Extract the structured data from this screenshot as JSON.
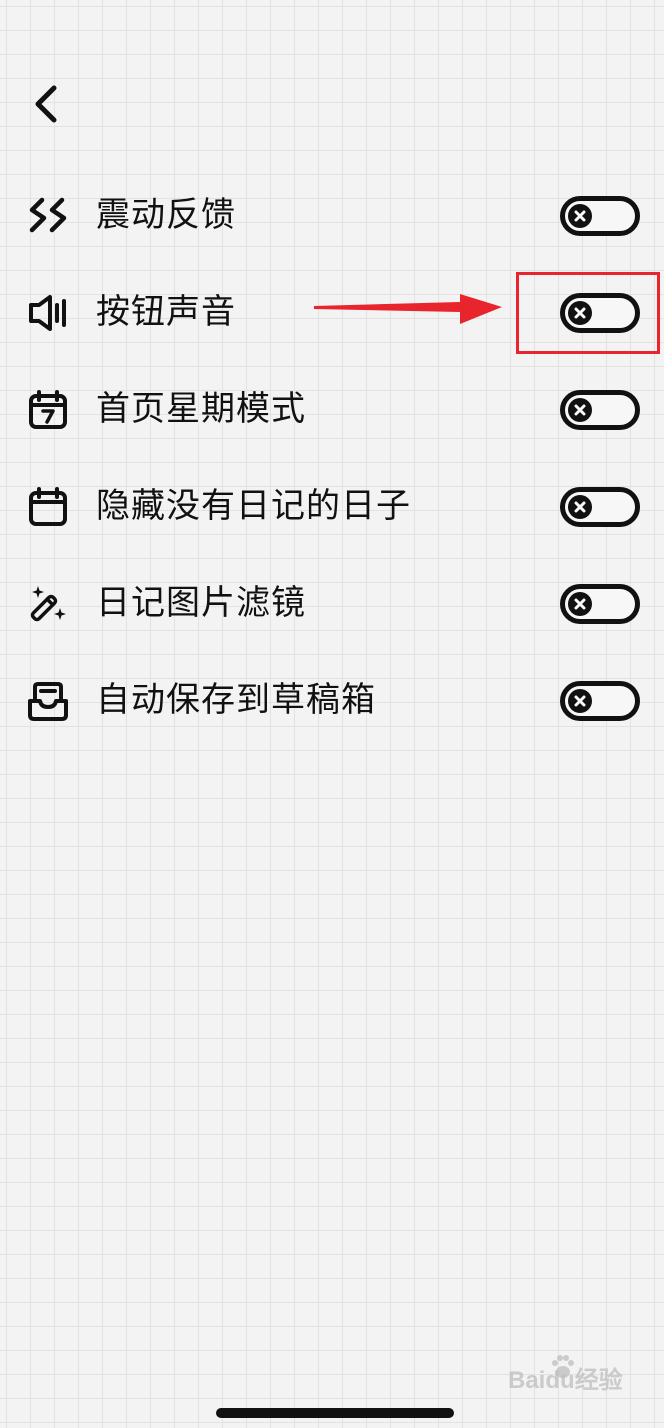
{
  "settings": [
    {
      "key": "vibration",
      "label": "震动反馈",
      "icon": "vibration-icon",
      "enabled": false
    },
    {
      "key": "button-sound",
      "label": "按钮声音",
      "icon": "speaker-icon",
      "enabled": false
    },
    {
      "key": "home-week-mode",
      "label": "首页星期模式",
      "icon": "calendar-week-icon",
      "enabled": false
    },
    {
      "key": "hide-empty-days",
      "label": "隐藏没有日记的日子",
      "icon": "calendar-icon",
      "enabled": false
    },
    {
      "key": "image-filter",
      "label": "日记图片滤镜",
      "icon": "magic-wand-icon",
      "enabled": false
    },
    {
      "key": "autosave-drafts",
      "label": "自动保存到草稿箱",
      "icon": "drafts-box-icon",
      "enabled": false
    }
  ],
  "annotation": {
    "color": "#e8242c",
    "target": "button-sound"
  },
  "watermark": {
    "text": "Bai",
    "text2": "du",
    "text3": "经验"
  },
  "icons": {
    "back": "chevron-left-icon",
    "toggle_off": "close-icon"
  }
}
